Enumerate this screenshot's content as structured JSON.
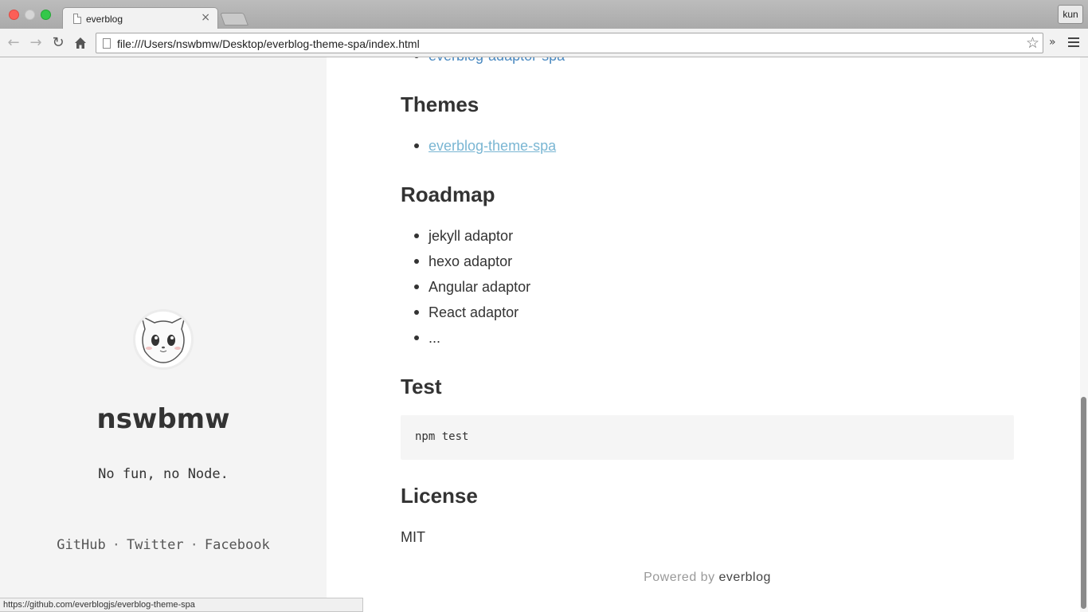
{
  "browser": {
    "tab_title": "everblog",
    "tab_close": "×",
    "user_button": "kun",
    "url": "file:///Users/nswbmw/Desktop/everblog-theme-spa/index.html",
    "back_icon": "arrow-back",
    "forward_icon": "arrow-forward",
    "reload_icon": "reload",
    "home_icon": "home",
    "extensions_chevron": "»",
    "status_url": "https://github.com/everblogjs/everblog-theme-spa"
  },
  "sidebar": {
    "name": "nswbmw",
    "bio": "No fun, no Node.",
    "links": [
      "GitHub",
      "Twitter",
      "Facebook"
    ],
    "separator": "·"
  },
  "content": {
    "partial_top_link": "everblog-adaptor-spa",
    "themes_heading": "Themes",
    "themes_items": [
      "everblog-theme-spa"
    ],
    "roadmap_heading": "Roadmap",
    "roadmap_items": [
      "jekyll adaptor",
      "hexo adaptor",
      "Angular adaptor",
      "React adaptor",
      "..."
    ],
    "test_heading": "Test",
    "test_code": "npm test",
    "license_heading": "License",
    "license_text": "MIT"
  },
  "footer": {
    "prefix": "Powered by",
    "brand": "everblog"
  },
  "colors": {
    "link": "#4a89c0",
    "link_hover": "#7ab6d3",
    "sidebar_bg": "#f4f4f4",
    "code_bg": "#f5f5f5"
  }
}
